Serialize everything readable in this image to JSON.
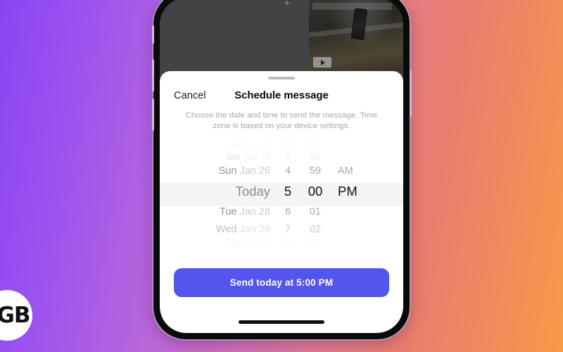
{
  "background": {
    "gradient_from": "#8A45F2",
    "gradient_mid": "#E67C82",
    "gradient_to": "#F79A48",
    "logo_text": "GB"
  },
  "phone_app": {
    "play_icon": "play-icon",
    "attachment_icon": "✦"
  },
  "sheet": {
    "cancel_label": "Cancel",
    "title": "Schedule message",
    "subtitle": "Choose the date and time to send the message. Time zone is based on your device settings.",
    "accent_color": "#5356EE",
    "selected_row_color": "#f4f4f5"
  },
  "picker": {
    "rows": [
      {
        "day": "Fri",
        "month": "Jan 24",
        "hour": "2",
        "minute": "57",
        "ampm": "",
        "state": "edge"
      },
      {
        "day": "Sat",
        "month": "Jan 25",
        "hour": "3",
        "minute": "58",
        "ampm": "",
        "state": "far"
      },
      {
        "day": "Sun",
        "month": "Jan 26",
        "hour": "4",
        "minute": "59",
        "ampm": "AM",
        "state": "near"
      },
      {
        "day": "Today",
        "month": "",
        "hour": "5",
        "minute": "00",
        "ampm": "PM",
        "state": "selected"
      },
      {
        "day": "Tue",
        "month": "Jan 28",
        "hour": "6",
        "minute": "01",
        "ampm": "",
        "state": "near"
      },
      {
        "day": "Wed",
        "month": "Jan 29",
        "hour": "7",
        "minute": "02",
        "ampm": "",
        "state": "mid"
      },
      {
        "day": "Thu",
        "month": "Jan 30",
        "hour": "8",
        "minute": "03",
        "ampm": "",
        "state": "edge"
      }
    ],
    "selected_date": "Today",
    "selected_hour": "5",
    "selected_minute": "00",
    "selected_ampm": "PM"
  },
  "send": {
    "label": "Send today at 5:00 PM"
  }
}
